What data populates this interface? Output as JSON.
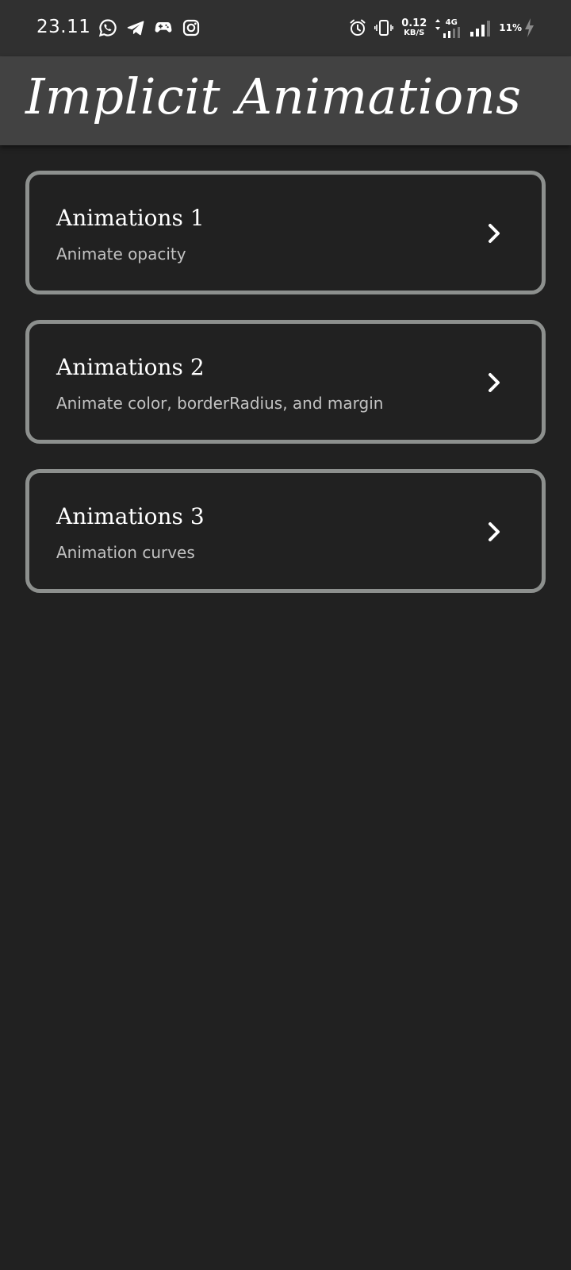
{
  "status_bar": {
    "time": "23.11",
    "left_icons": [
      "whatsapp-icon",
      "telegram-icon",
      "gamepad-icon",
      "instagram-icon"
    ],
    "right_icons": [
      "alarm-icon",
      "vibrate-icon",
      "data-arrows-icon",
      "signal-icon",
      "charging-icon"
    ],
    "net_speed_value": "0.12",
    "net_speed_unit": "KB/S",
    "network_type": "4G",
    "battery": "11%"
  },
  "app_bar": {
    "title": "Implicit Animations"
  },
  "cards": [
    {
      "title": "Animations 1",
      "subtitle": "Animate opacity",
      "icon": "chevron-right-icon"
    },
    {
      "title": "Animations 2",
      "subtitle": "Animate color,  borderRadius,  and margin",
      "icon": "chevron-right-icon"
    },
    {
      "title": "Animations 3",
      "subtitle": "Animation curves",
      "icon": "chevron-right-icon"
    }
  ],
  "colors": {
    "background": "#212121",
    "status_bar": "#303030",
    "app_bar": "#424242",
    "card_border": "#8d908e",
    "subtitle_text": "#c2c2c2"
  }
}
